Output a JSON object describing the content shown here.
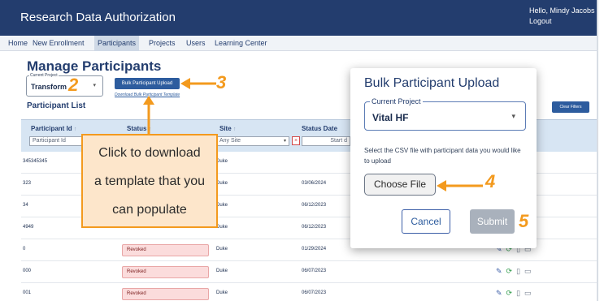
{
  "app": {
    "title": "Research Data Authorization",
    "greeting": "Hello, Mindy Jacobs",
    "logout": "Logout"
  },
  "nav": {
    "items": [
      "Home",
      "New Enrollment",
      "Participants",
      "Projects",
      "Users",
      "Learning Center"
    ],
    "active": "Participants"
  },
  "page": {
    "title": "Manage Participants",
    "current_project_label": "Current Project",
    "current_project_value": "Transform",
    "bulk_upload_button": "Bulk Participant Upload",
    "template_link": "Download Bulk Participant Template",
    "list_title": "Participant List",
    "clear_filters_button": "Clear Filters"
  },
  "table": {
    "headers": [
      "Participant Id",
      "Status",
      "Site",
      "Status Date"
    ],
    "sort_glyph": "↑",
    "filters": {
      "participant_id_placeholder": "Participant Id",
      "site_value": "Any Site",
      "status_date_placeholder": "Start d"
    },
    "rows": [
      {
        "id": "345345345",
        "status": "",
        "site": "Duke",
        "date": ""
      },
      {
        "id": "323",
        "status": "",
        "site": "Duke",
        "date": "03/06/2024"
      },
      {
        "id": "34",
        "status": "",
        "site": "Duke",
        "date": "06/12/2023"
      },
      {
        "id": "4949",
        "status": "",
        "site": "Duke",
        "date": "06/12/2023"
      },
      {
        "id": "0",
        "status": "Revoked",
        "site": "Duke",
        "date": "01/29/2024"
      },
      {
        "id": "000",
        "status": "Revoked",
        "site": "Duke",
        "date": "06/07/2023"
      },
      {
        "id": "001",
        "status": "Revoked",
        "site": "Duke",
        "date": "06/07/2023"
      }
    ]
  },
  "callout": {
    "lines": [
      "Click to download",
      "a template that you",
      "can populate"
    ]
  },
  "modal": {
    "title": "Bulk Participant Upload",
    "project_label": "Current Project",
    "project_value": "Vital HF",
    "description": "Select the CSV file with participant data you would like to upload",
    "choose_file": "Choose File",
    "cancel": "Cancel",
    "submit": "Submit"
  },
  "annotations": {
    "n2": "2",
    "n3": "3",
    "n4": "4",
    "n5": "5"
  },
  "colors": {
    "header_bg": "#233d6e",
    "primary": "#2d5c9e",
    "annotation": "#f39a1e",
    "callout_bg": "#fde6cb",
    "revoked_bg": "#fbdcdc"
  }
}
